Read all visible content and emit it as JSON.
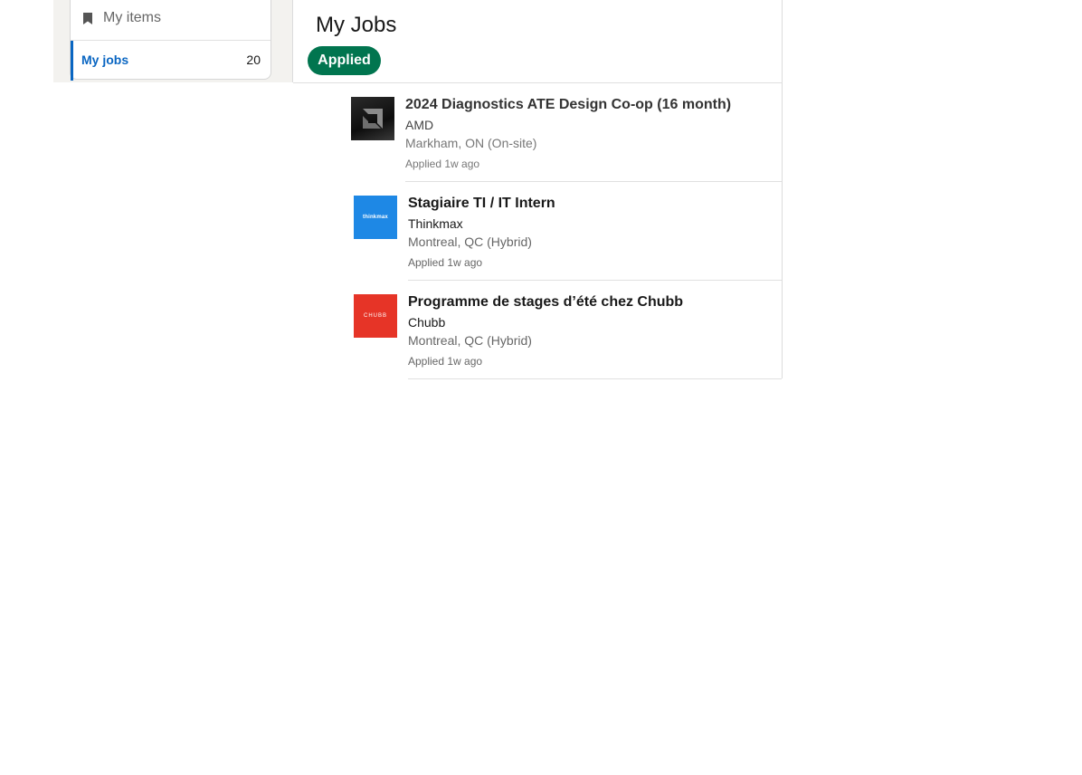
{
  "sidebar": {
    "my_items_label": "My items",
    "items": [
      {
        "label": "My jobs",
        "count": "20",
        "active": true
      }
    ]
  },
  "main": {
    "title": "My Jobs",
    "filter_pill": "Applied"
  },
  "jobs": [
    {
      "title": "2024 Diagnostics ATE Design Co-op (16 month)",
      "company": "AMD",
      "location": "Markham, ON (On-site)",
      "applied": "Applied 1w ago",
      "logo": "amd-logo"
    },
    {
      "title": "Stagiaire TI / IT Intern",
      "company": "Thinkmax",
      "location": "Montreal, QC (Hybrid)",
      "applied": "Applied 1w ago",
      "logo": "thinkmax-logo",
      "logo_text": "thinkmax"
    },
    {
      "title": "Programme de stages d’été chez Chubb",
      "company": "Chubb",
      "location": "Montreal, QC (Hybrid)",
      "applied": "Applied 1w ago",
      "logo": "chubb-logo",
      "logo_text": "CHUBB"
    }
  ],
  "colors": {
    "accent_blue": "#0a66c2",
    "applied_green": "#01754f",
    "page_bg": "#f3f2ef"
  }
}
